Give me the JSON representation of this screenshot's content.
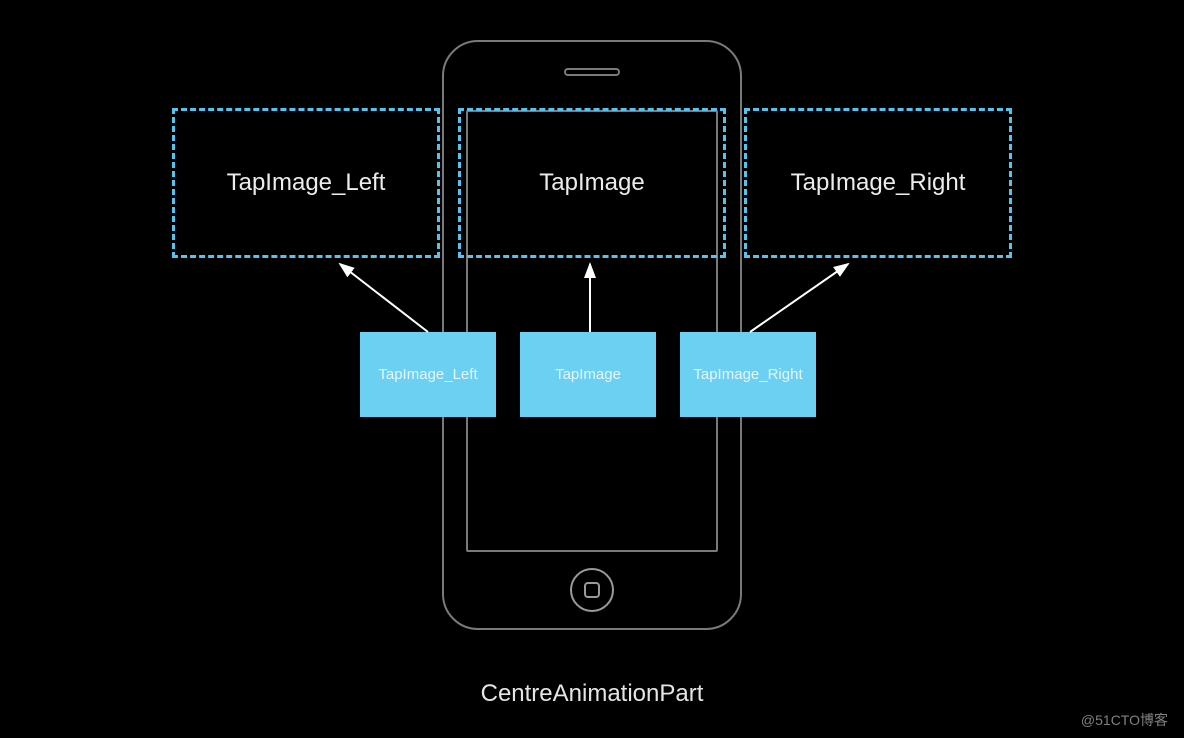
{
  "targets": {
    "left": {
      "label": "TapImage_Left"
    },
    "center": {
      "label": "TapImage"
    },
    "right": {
      "label": "TapImage_Right"
    }
  },
  "sources": {
    "left": {
      "label": "TapImage_Left"
    },
    "center": {
      "label": "TapImage"
    },
    "right": {
      "label": "TapImage_Right"
    }
  },
  "caption": "CentreAnimationPart",
  "watermark": "@51CTO博客",
  "colors": {
    "dashed_border": "#55c3f0",
    "source_fill": "#6cd0f2",
    "phone_outline": "#7a7a7a"
  }
}
